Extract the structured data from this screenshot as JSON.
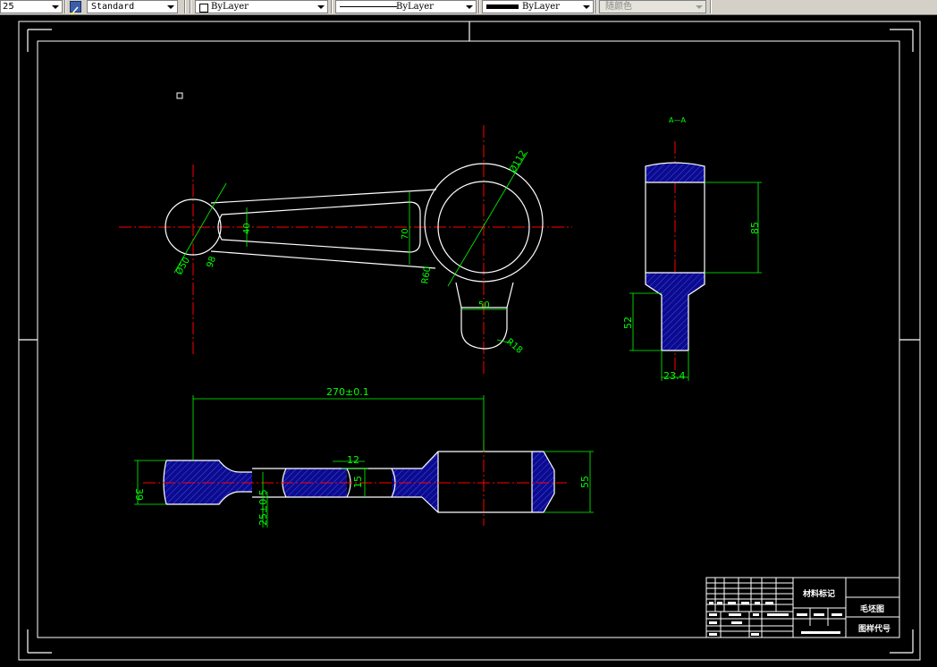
{
  "toolbar": {
    "scale_value": "25",
    "text_style": "Standard",
    "layer_value": "ByLayer",
    "linetype_value": "ByLayer",
    "lineweight_value": "ByLayer",
    "color_value": "随颜色"
  },
  "drawing": {
    "dims": {
      "phi112": "Ø112",
      "phi50": "Ø50",
      "r36": "98",
      "d40": "40",
      "d70": "70",
      "r60": "R60",
      "d50": "50",
      "r18": "R18",
      "section_label": "A—A",
      "d85": "85",
      "d52": "52",
      "d23_4": "23.4",
      "d270": "270±0.1",
      "d12": "12",
      "d15": "15",
      "d39": "39",
      "d25": "25±0.5",
      "d55": "55"
    },
    "title_block": {
      "material": "材料标记",
      "drawing_name": "毛坯图",
      "drawing_code": "图样代号"
    }
  },
  "colors": {
    "background": "#000000",
    "outline": "#ffffff",
    "centerline": "#ff0000",
    "dimension": "#00ff00",
    "hatch": "#0b0b8f"
  }
}
